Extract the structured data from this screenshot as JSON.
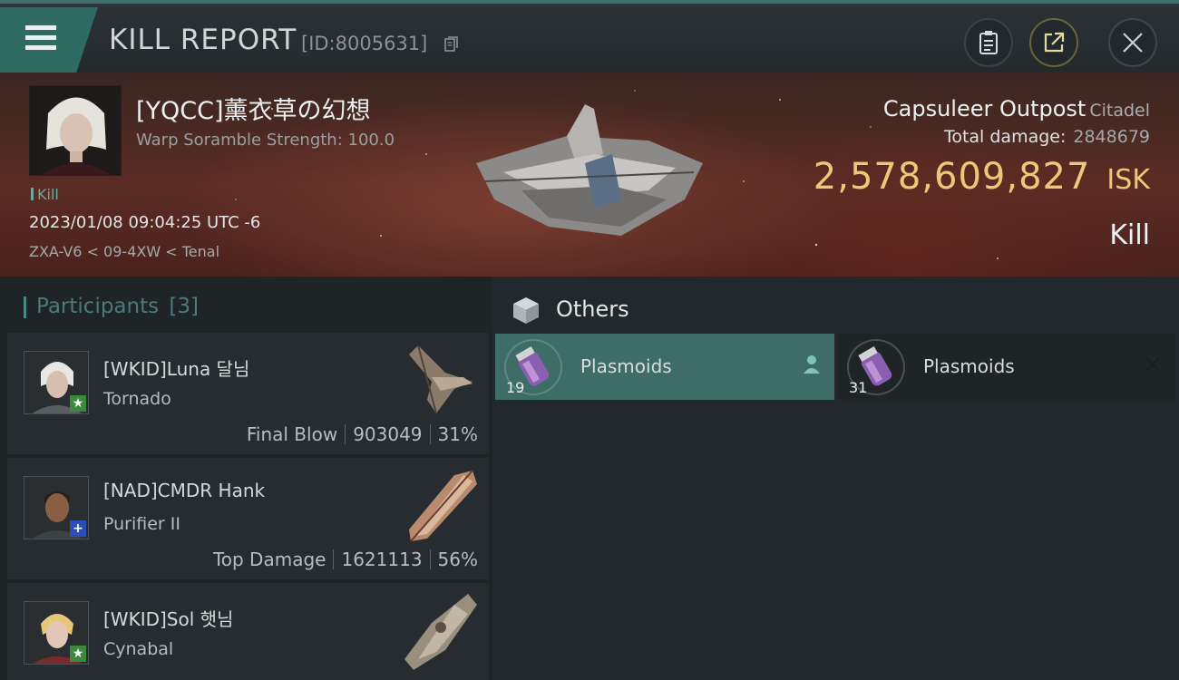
{
  "header": {
    "title": "KILL REPORT",
    "id_label": "[ID:8005631]"
  },
  "victim": {
    "name": "[YQCC]薰衣草の幻想",
    "subtitle": "Warp Soramble Strength: 100.0",
    "tag": "Kill",
    "datetime": "2023/01/08 09:04:25 UTC -6",
    "location": "ZXA-V6 < 09-4XW < Tenal"
  },
  "target": {
    "name": "Capsuleer Outpost",
    "class": "Citadel",
    "total_damage_label": "Total damage:",
    "total_damage": "2848679",
    "isk_value": "2,578,609,827",
    "isk_unit": "ISK",
    "result": "Kill"
  },
  "participants": {
    "label": "Participants",
    "count": "[3]",
    "items": [
      {
        "name": "[WKID]Luna 달님",
        "ship": "Tornado",
        "role": "Final Blow",
        "damage": "903049",
        "percent": "31%",
        "badge": "★"
      },
      {
        "name": "[NAD]CMDR Hank",
        "ship": "Purifier II",
        "role": "Top Damage",
        "damage": "1621113",
        "percent": "56%",
        "badge": "+"
      },
      {
        "name": "[WKID]Sol 햇님",
        "ship": "Cynabal",
        "badge": "★"
      }
    ]
  },
  "others": {
    "title": "Others",
    "items": [
      {
        "name": "Plasmoids",
        "qty": "19"
      },
      {
        "name": "Plasmoids",
        "qty": "31"
      }
    ]
  },
  "colors": {
    "accent_teal": "#3e6d67",
    "isk_gold": "#f0c77a",
    "hero_red": "#5a2c24"
  }
}
